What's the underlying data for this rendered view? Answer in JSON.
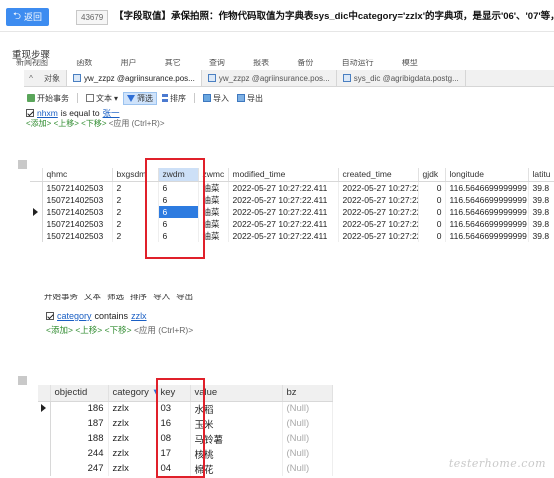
{
  "header": {
    "back_label": "返回",
    "issue_id": "43679",
    "issue_title": "【字段取值】承保拍照：作物代码取值为字典表sys_dic中category='zzlx'的字典项，是显示'06'、'07'等，不是'6'"
  },
  "section_title": "重现步骤",
  "cut_menu_items": [
    "新闻视图",
    "函数",
    "用户",
    "其它",
    "查询",
    "报表",
    "备份",
    "自动运行",
    "模型"
  ],
  "tabs": [
    {
      "label": "对象"
    },
    {
      "label": "yw_zzpz @agriinsurance.pos..."
    },
    {
      "label": "yw_zzpz @agriinsurance.pos..."
    },
    {
      "label": "sys_dic @agribigdata.postg..."
    }
  ],
  "toolbar1": {
    "begin_txn": "开始事务",
    "text": "文本",
    "filter": "筛选",
    "sort": "排序",
    "import": "导入",
    "export": "导出"
  },
  "filter1": {
    "field": "nhxm",
    "op": "is equal to",
    "value": "张一"
  },
  "hint_line": {
    "add": "<添加>",
    "up": "<上移>",
    "down": "<下移>",
    "apply": "<应用 (Ctrl+R)>"
  },
  "grid1": {
    "columns": [
      "qhmc",
      "bxgsdm",
      "zwdm",
      "zwmc",
      "modified_time",
      "created_time",
      "gjdk",
      "longitude",
      "latitu"
    ],
    "rows": [
      [
        "150721402503",
        "2",
        "6",
        "油菜",
        "2022-05-27 10:27:22.411",
        "2022-05-27 10:27:22.4",
        "0",
        "116.5646699999999",
        "39.8"
      ],
      [
        "150721402503",
        "2",
        "6",
        "油菜",
        "2022-05-27 10:27:22.411",
        "2022-05-27 10:27:22.4",
        "0",
        "116.5646699999999",
        "39.8"
      ],
      [
        "150721402503",
        "2",
        "6",
        "油菜",
        "2022-05-27 10:27:22.411",
        "2022-05-27 10:27:22.4",
        "0",
        "116.5646699999999",
        "39.8"
      ],
      [
        "150721402503",
        "2",
        "6",
        "油菜",
        "2022-05-27 10:27:22.411",
        "2022-05-27 10:27:22.4",
        "0",
        "116.5646699999999",
        "39.8"
      ],
      [
        "150721402503",
        "2",
        "6",
        "油菜",
        "2022-05-27 10:27:22.411",
        "2022-05-27 10:27:22.4",
        "0",
        "116.5646699999999",
        "39.8"
      ]
    ]
  },
  "filter2": {
    "field": "category",
    "op": "contains",
    "value": "zzlx"
  },
  "grid2": {
    "columns": [
      "objectid",
      "category",
      "key",
      "value",
      "bz"
    ],
    "rows": [
      [
        "186",
        "zzlx",
        "03",
        "水稻",
        "(Null)"
      ],
      [
        "187",
        "zzlx",
        "16",
        "玉米",
        "(Null)"
      ],
      [
        "188",
        "zzlx",
        "08",
        "马铃薯",
        "(Null)"
      ],
      [
        "244",
        "zzlx",
        "17",
        "核桃",
        "(Null)"
      ],
      [
        "247",
        "zzlx",
        "04",
        "棉花",
        "(Null)"
      ]
    ]
  },
  "watermark": "testerhome.com",
  "colors": {
    "accent": "#3d8cf0",
    "highlight_cell": "#2d7be0",
    "annotation_red": "#e0202a"
  }
}
